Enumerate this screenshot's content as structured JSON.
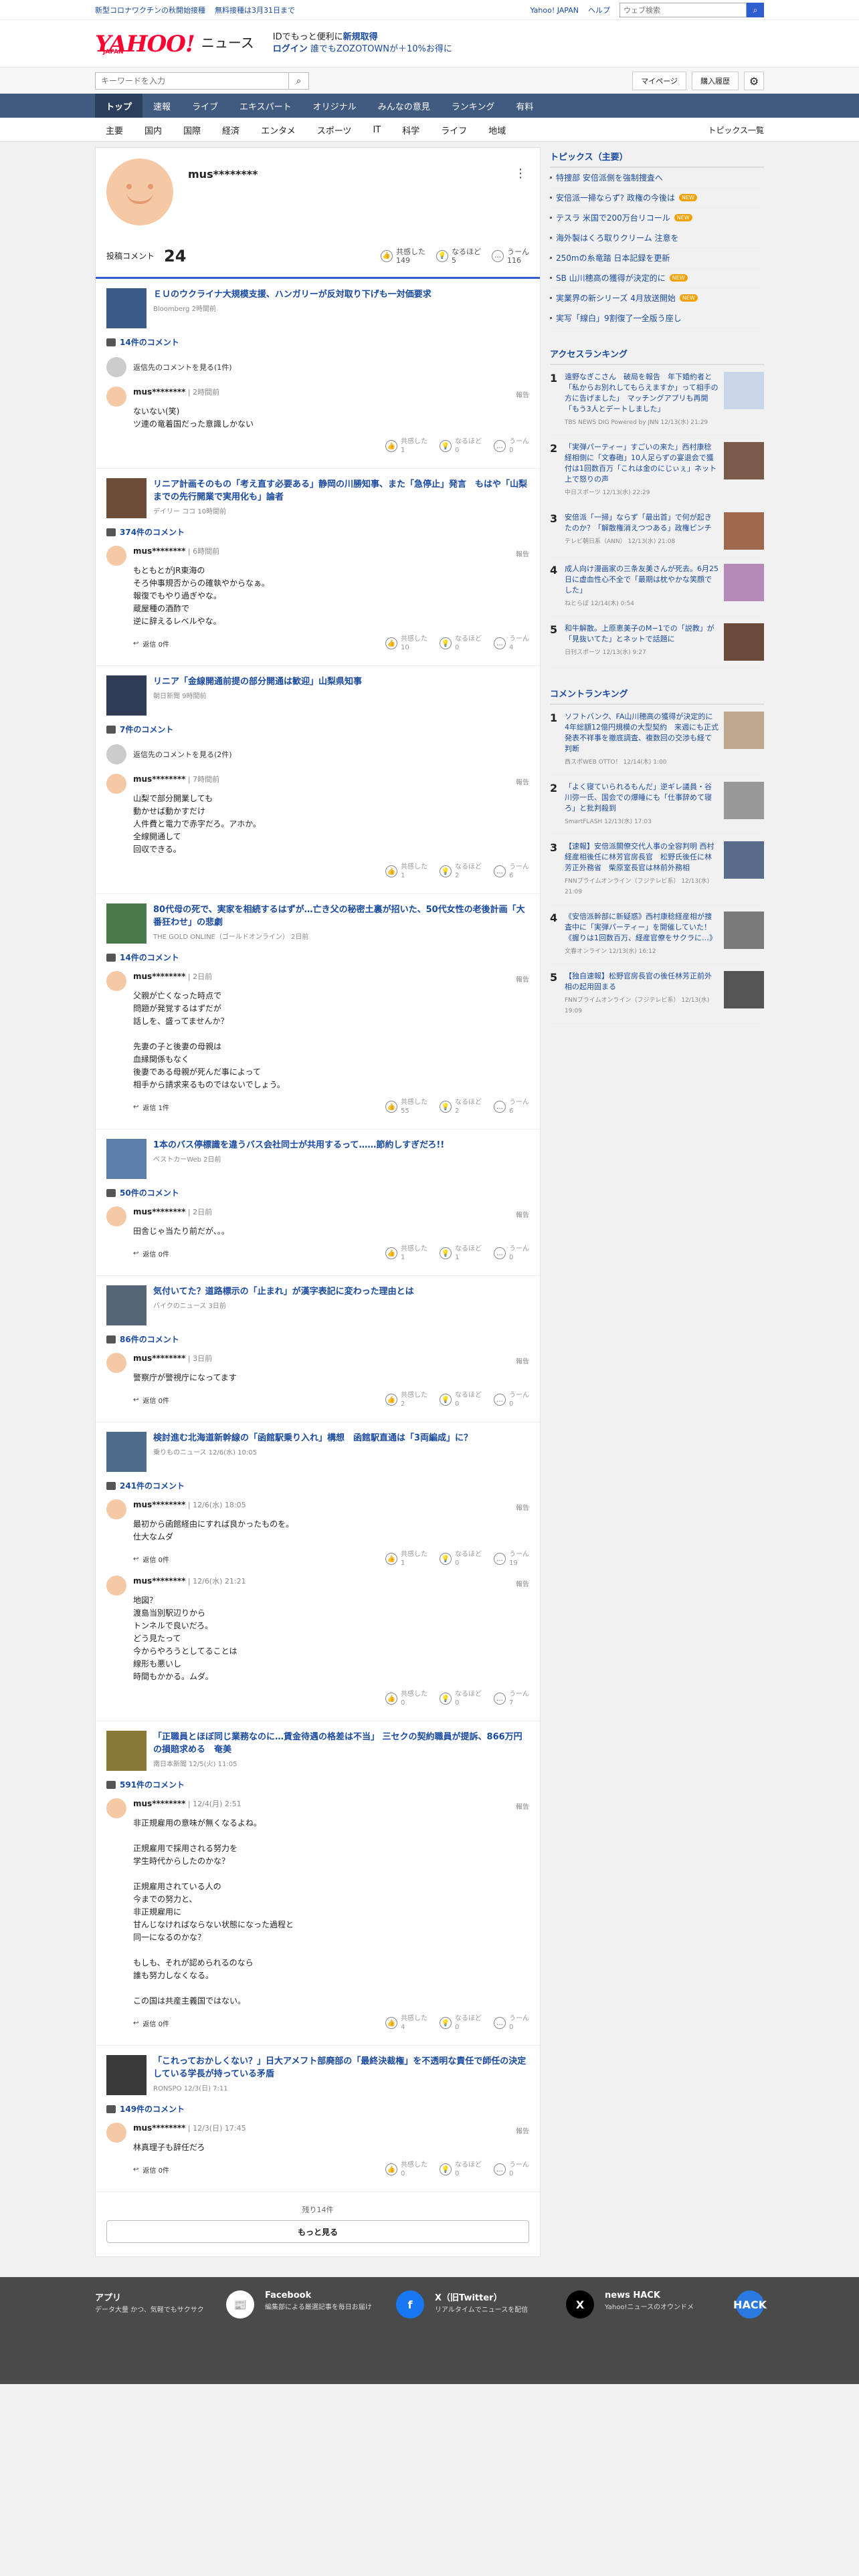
{
  "topbar": {
    "links": [
      "新型コロナワクチンの秋開始接種",
      "無料接種は3月31日まで"
    ],
    "right_links": [
      "Yahoo! JAPAN",
      "ヘルプ"
    ],
    "search_placeholder": "ウェブ検索"
  },
  "header": {
    "logo": "YAHOO!",
    "logo_sub": "JAPAN",
    "logo_news": "ニュース",
    "promo_line1_a": "IDでもっと便利に",
    "promo_line1_b": "新規取得",
    "promo_line2_a": "ログイン",
    "promo_line2_b": "誰でもZOZOTOWNが＋10%お得に"
  },
  "search": {
    "placeholder": "キーワードを入力",
    "mypage": "マイページ",
    "purchase": "購入履歴"
  },
  "nav_primary": [
    "トップ",
    "速報",
    "ライブ",
    "エキスパート",
    "オリジナル",
    "みんなの意見",
    "ランキング",
    "有料"
  ],
  "nav_secondary": [
    "主要",
    "国内",
    "国際",
    "経済",
    "エンタメ",
    "スポーツ",
    "IT",
    "科学",
    "ライフ",
    "地域"
  ],
  "nav_all": "トピックス一覧",
  "profile": {
    "username": "mus********",
    "posted_label": "投稿コメント",
    "posted_count": "24",
    "reactions": [
      {
        "label": "共感した",
        "count": "149",
        "icon": "thumb-icon"
      },
      {
        "label": "なるほど",
        "count": "5",
        "icon": "lightbulb-icon"
      },
      {
        "label": "うーん",
        "count": "116",
        "icon": "hmm-icon"
      }
    ]
  },
  "articles": [
    {
      "title": "ＥＵのウクライナ大規模支援、ハンガリーが反対取り下げも一対価要求",
      "source": "Bloomberg 2時間前",
      "thumb_color": "#3b5b86",
      "comment_count": "14件のコメント",
      "parent": "返信先のコメントを見る(1件)",
      "comments": [
        {
          "user": "mus********",
          "time": "2時間前",
          "body": "ないない(笑)\nツ連の竜着国だった意識しかない",
          "likes": "1",
          "naruhodo": "0",
          "hmm": "0",
          "reply": ""
        }
      ]
    },
    {
      "title": "リニア計画そのもの「考え直す必要ある」静岡の川勝知事、また「急停止」発言　もはや「山梨までの先行開業で実用化も」論者",
      "source": "デイリー ココ 10時間前",
      "thumb_color": "#6b4d3a",
      "comment_count": "374件のコメント",
      "parent": "",
      "comments": [
        {
          "user": "mus********",
          "time": "6時間前",
          "body": "もともとがJR東海の\nそろ仲事規否からの確執やからなぁ。\n報復でもやり過ぎやな。\n蔵屋種の酒酢で\n逆に辞えるレベルやな。",
          "likes": "10",
          "naruhodo": "0",
          "hmm": "4",
          "reply": "返信 0件"
        }
      ]
    },
    {
      "title": "リニア「金線開通前提の部分開通は歓迎」山梨県知事",
      "source": "朝日新聞 9時間前",
      "thumb_color": "#2e3d55",
      "comment_count": "7件のコメント",
      "parent": "返信先のコメントを見る(2件)",
      "comments": [
        {
          "user": "mus********",
          "time": "7時間前",
          "body": "山梨で部分開業しても\n動かせば動かすだけ\n人件費と電力で赤字だろ。アホか。\n全線開通して\n回収できる。",
          "likes": "1",
          "naruhodo": "2",
          "hmm": "6",
          "reply": ""
        }
      ]
    },
    {
      "title": "80代母の死で、実家を相続するはずが…亡き父の秘密土裏が招いた、50代女性の老後計画「大番狂わせ」の悲劇",
      "source": "THE GOLD ONLINE（ゴールドオンライン） 2日前",
      "thumb_color": "#4a7a4a",
      "comment_count": "14件のコメント",
      "parent": "",
      "comments": [
        {
          "user": "mus********",
          "time": "2日前",
          "body": "父親が亡くなった時点で\n問題が発覚するはずだが\n話しを、盛ってませんか？\n\n先妻の子と後妻の母親は\n血縁関係もなく\n後妻である母親が死んだ事によって\n相手から請求来るものではないでしょう。",
          "likes": "55",
          "naruhodo": "2",
          "hmm": "6",
          "reply": "返信 1件"
        }
      ]
    },
    {
      "title": "1本のバス停標識を違うバス会社同士が共用するって……節約しすぎだろ!!",
      "source": "ベストカーWeb 2日前",
      "thumb_color": "#5b7fa8",
      "comment_count": "50件のコメント",
      "parent": "",
      "comments": [
        {
          "user": "mus********",
          "time": "2日前",
          "body": "田舎じゃ当たり前だが、。。",
          "likes": "1",
          "naruhodo": "1",
          "hmm": "0",
          "reply": "返信 0件"
        }
      ]
    },
    {
      "title": "気付いてた？道路標示の「止まれ」が漢字表記に変わった理由とは",
      "source": "バイクのニュース 3日前",
      "thumb_color": "#556677",
      "comment_count": "86件のコメント",
      "parent": "",
      "comments": [
        {
          "user": "mus********",
          "time": "3日前",
          "body": "警察庁が警視庁になってます",
          "likes": "2",
          "naruhodo": "0",
          "hmm": "0",
          "reply": "返信 0件"
        }
      ]
    },
    {
      "title": "検討進む北海道新幹線の「函館駅乗り入れ」構想　函館駅直通は「3両編成」に？",
      "source": "乗りものニュース 12/6(水) 10:05",
      "thumb_color": "#4d6b8a",
      "comment_count": "241件のコメント",
      "parent": "",
      "comments": [
        {
          "user": "mus********",
          "time": "12/6(水) 18:05",
          "body": "最初から函館経由にすれば良かったものを。\n仕大なムダ",
          "likes": "1",
          "naruhodo": "0",
          "hmm": "19",
          "reply": "返信 0件"
        },
        {
          "user": "mus********",
          "time": "12/6(水) 21:21",
          "body": "地図？\n渡島当別駅辺りから\nトンネルで良いだろ。\nどう見たって\n今からやろうとしてることは\n線形も悪いし\n時間もかかる。ムダ。",
          "likes": "0",
          "naruhodo": "0",
          "hmm": "7",
          "reply": ""
        }
      ]
    },
    {
      "title": "「正職員とほぼ同じ業務なのに…賃金待遇の格差は不当」 三セクの契約職員が提訴、866万円の損賠求める　奄美",
      "source": "南日本新聞 12/5(火) 11:05",
      "thumb_color": "#8a7a3a",
      "comment_count": "591件のコメント",
      "parent": "",
      "comments": [
        {
          "user": "mus********",
          "time": "12/4(月) 2:51",
          "body": "非正規雇用の意味が無くなるよね。\n\n正規雇用で採用される努力を\n学生時代からしたのかな？\n\n正規雇用されている人の\n今までの努力と、\n非正規雇用に\n甘んじなければならない状態になった過程と\n同一になるのかな？\n\nもしも、それが認められるのなら\n誰も努力しなくなる。\n\nこの国は共産主義国ではない。",
          "likes": "4",
          "naruhodo": "0",
          "hmm": "0",
          "reply": "返信 0件"
        }
      ]
    },
    {
      "title": "「これっておかしくない？」日大アメフト部廃部の「最終決裁権」を不透明な責任で師任の決定している学長が持っている矛盾",
      "source": "RONSPO 12/3(日) 7:11",
      "thumb_color": "#3a3a3a",
      "comment_count": "149件のコメント",
      "parent": "",
      "comments": [
        {
          "user": "mus********",
          "time": "12/3(日) 17:45",
          "body": "林真理子も辞任だろ",
          "likes": "0",
          "naruhodo": "0",
          "hmm": "0",
          "reply": "返信 0件"
        }
      ]
    }
  ],
  "reaction_labels": {
    "likes": "共感した",
    "naruhodo": "なるほど",
    "hmm": "うーん"
  },
  "report_label": "報告",
  "remaining": "残り14件",
  "more_button": "もっと見る",
  "sidebar": {
    "topics_header": "トピックス（主要）",
    "topics": [
      {
        "text": "特捜部 安倍派側を強制捜査へ",
        "badge": ""
      },
      {
        "text": "安倍派一掃ならず? 政権の今後は",
        "badge": "NEW"
      },
      {
        "text": "テスラ 米国で200万台リコール",
        "badge": "NEW"
      },
      {
        "text": "海外製はくろ取りクリーム 注意を",
        "badge": ""
      },
      {
        "text": "250mの糸竜踏 日本記録を更新",
        "badge": ""
      },
      {
        "text": "SB 山川穂高の獲得が決定的に",
        "badge": "NEW"
      },
      {
        "text": "実業界の新シリーズ 4月放送開始",
        "badge": "NEW"
      },
      {
        "text": "実写「線白」9割復了一全版う座し",
        "badge": ""
      }
    ],
    "ranking_header": "アクセスランキング",
    "ranking": [
      {
        "n": "1",
        "text": "遠野なぎこさん　破局を報告　年下婚約者と　「私からお別れしてもらえますか」って相手の方に告げました」　マッチングアプリも再開　「もう3人とデートしました」",
        "meta": "TBS NEWS DIG Powered by JNN 12/13(水) 21:29",
        "color": "#c8d6e8"
      },
      {
        "n": "2",
        "text": "「実弾パーティー」すごいの来た」西村康稔経相側に「文春砲」10人足らずの宴退会で獲付は1回数百万「これは金のにじぃぇ」ネット上で怒りの声",
        "meta": "中日スポーツ 12/13(水) 22:29",
        "color": "#7a5a4a"
      },
      {
        "n": "3",
        "text": "安倍派「一掃」ならず「最出首」で何が起きたのか？「解散権消えつつある」政権ピンチ",
        "meta": "テレビ朝日系（ANN） 12/13(水) 21:08",
        "color": "#a06a50"
      },
      {
        "n": "4",
        "text": "成人向け漫画家の三条友美さんが死去。6月25日に虚血性心不全で「最期は枕やかな笑顔でした」",
        "meta": "ねとらぼ 12/14(木) 0:54",
        "color": "#b68ab8"
      },
      {
        "n": "5",
        "text": "和牛解散。上原恵美子のM−1での「説教」が「見抜いてた」とネットで話題に",
        "meta": "日刊スポーツ 12/13(水) 9:27",
        "color": "#6a4a3a"
      }
    ],
    "comment_ranking_header": "コメントランキング",
    "comment_ranking": [
      {
        "n": "1",
        "text": "ソフトバンク、FA山川穂高の獲得が決定的に　4年総額12億円規模の大型契約　来週にも正式発表不祥事を撤底調査、複数回の交渉も経て判断",
        "meta": "西スポWEB OTTO！ 12/14(木) 1:00",
        "color": "#c0a890"
      },
      {
        "n": "2",
        "text": "「よく寝ていられるもんだ」逆ギレ議員・谷川弥一氏、国会での爆睡にも「仕事辞めて寝ろ」と批判殺到",
        "meta": "SmartFLASH 12/13(水) 17:03",
        "color": "#999"
      },
      {
        "n": "3",
        "text": "【速報】安倍派閣僚交代人事の全容判明 西村経産相後任に林芳官房長官　松野氏後任に林芳正外務省　柴原室長官は林前外務相",
        "meta": "FNNプライムオンライン（フジテレビ系） 12/13(水) 21:09",
        "color": "#5a6a8a"
      },
      {
        "n": "4",
        "text": "《安倍派幹部に新疑惑》西村康稔経産相が捜査中に「実弾パーティー」を開催していた！《握りは1回数百万、経産官僚をサクラに…》",
        "meta": "文春オンライン 12/13(水) 16:12",
        "color": "#7a7a7a"
      },
      {
        "n": "5",
        "text": "【独自速報】松野官房長官の後任林芳正前外相の起用固まる",
        "meta": "FNNプライムオンライン（フジテレビ系） 12/13(水) 19:09",
        "color": "#555"
      }
    ]
  },
  "footer": [
    {
      "title": "アプリ",
      "desc": "データ大量 かつ、気軽でもサクサク",
      "icon": "app-icon",
      "icon_text": "📰",
      "color": "#ffffff"
    },
    {
      "title": "Facebook",
      "desc": "編集部による厳選記事を毎日お届け",
      "icon": "facebook-icon",
      "icon_text": "f",
      "color": "#1877f2"
    },
    {
      "title": "X（旧Twitter）",
      "desc": "リアルタイムでニュースを配信",
      "icon": "x-icon",
      "icon_text": "X",
      "color": "#000000"
    },
    {
      "title": "news HACK",
      "desc": "Yahoo!ニュースのオウンドメ",
      "icon": "newshack-icon",
      "icon_text": "HACK",
      "color": "#2a7ae2"
    }
  ]
}
